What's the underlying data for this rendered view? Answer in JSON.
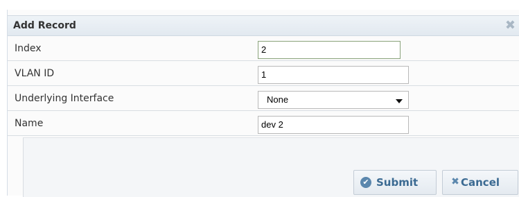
{
  "dialog": {
    "title": "Add Record",
    "close_icon": "close-icon"
  },
  "fields": {
    "index": {
      "label": "Index",
      "value": "2"
    },
    "vlan_id": {
      "label": "VLAN ID",
      "value": "1"
    },
    "underlying_interface": {
      "label": "Underlying Interface",
      "value": "None"
    },
    "name": {
      "label": "Name",
      "value": "dev 2"
    }
  },
  "buttons": {
    "submit": {
      "label": "Submit",
      "icon": "check-circle-icon"
    },
    "cancel": {
      "label": "Cancel",
      "icon": "x-icon"
    }
  },
  "colors": {
    "title_bar": "#e8eef4",
    "button_text": "#3b6a92",
    "focused_field_border": "#8aa37b"
  }
}
